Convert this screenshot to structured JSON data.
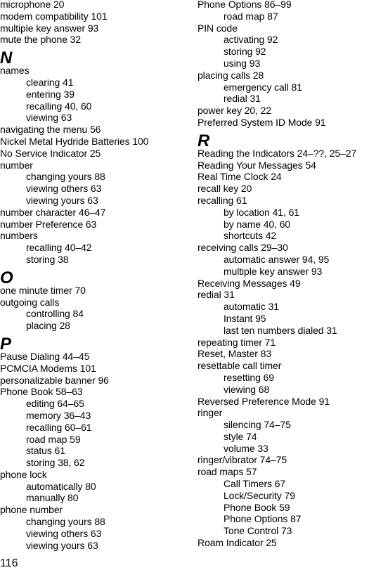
{
  "page_number": "116",
  "left_column": [
    {
      "type": "entry",
      "text": "microphone 20"
    },
    {
      "type": "entry",
      "text": "modem compatibility 101"
    },
    {
      "type": "entry",
      "text": "multiple key answer 93"
    },
    {
      "type": "entry",
      "text": "mute the phone 32"
    },
    {
      "type": "letter",
      "text": "N"
    },
    {
      "type": "entry",
      "text": "names"
    },
    {
      "type": "sub",
      "text": "clearing 41"
    },
    {
      "type": "sub",
      "text": "entering 39"
    },
    {
      "type": "sub",
      "text": "recalling 40, 60"
    },
    {
      "type": "sub",
      "text": "viewing 63"
    },
    {
      "type": "entry",
      "text": "navigating the menu 56"
    },
    {
      "type": "entry",
      "text": "Nickel Metal Hydride Batteries 100"
    },
    {
      "type": "entry",
      "text": "No Service Indicator 25"
    },
    {
      "type": "entry",
      "text": "number"
    },
    {
      "type": "sub",
      "text": "changing yours 88"
    },
    {
      "type": "sub",
      "text": "viewing others 63"
    },
    {
      "type": "sub",
      "text": "viewing yours 63"
    },
    {
      "type": "entry",
      "text": "number character 46–47"
    },
    {
      "type": "entry",
      "text": "number Preference 63"
    },
    {
      "type": "entry",
      "text": "numbers"
    },
    {
      "type": "sub",
      "text": "recalling 40–42"
    },
    {
      "type": "sub",
      "text": "storing 38"
    },
    {
      "type": "letter",
      "text": "O"
    },
    {
      "type": "entry",
      "text": "one minute timer 70"
    },
    {
      "type": "entry",
      "text": "outgoing calls"
    },
    {
      "type": "sub",
      "text": "controlling 84"
    },
    {
      "type": "sub",
      "text": "placing 28"
    },
    {
      "type": "letter",
      "text": "P"
    },
    {
      "type": "entry",
      "text": "Pause Dialing 44–45"
    },
    {
      "type": "entry",
      "text": "PCMCIA Modems 101"
    },
    {
      "type": "entry",
      "text": "personalizable banner 96"
    },
    {
      "type": "entry",
      "text": "Phone Book 58–63"
    },
    {
      "type": "sub",
      "text": "editing 64–65"
    },
    {
      "type": "sub",
      "text": "memory 36–43"
    },
    {
      "type": "sub",
      "text": "recalling 60–61"
    },
    {
      "type": "sub",
      "text": "road map 59"
    },
    {
      "type": "sub",
      "text": "status 61"
    },
    {
      "type": "sub",
      "text": "storing 38, 62"
    },
    {
      "type": "entry",
      "text": "phone lock"
    },
    {
      "type": "sub",
      "text": "automatically 80"
    },
    {
      "type": "sub",
      "text": "manually 80"
    },
    {
      "type": "entry",
      "text": "phone number"
    },
    {
      "type": "sub",
      "text": "changing yours 88"
    },
    {
      "type": "sub",
      "text": "viewing others 63"
    },
    {
      "type": "sub",
      "text": "viewing yours 63"
    }
  ],
  "right_column": [
    {
      "type": "entry",
      "text": "Phone Options 86–99"
    },
    {
      "type": "sub",
      "text": "road map 87"
    },
    {
      "type": "entry",
      "text": "PIN code"
    },
    {
      "type": "sub",
      "text": "activating 92"
    },
    {
      "type": "sub",
      "text": "storing 92"
    },
    {
      "type": "sub",
      "text": "using 93"
    },
    {
      "type": "entry",
      "text": "placing calls 28"
    },
    {
      "type": "sub",
      "text": "emergency call 81"
    },
    {
      "type": "sub",
      "text": "redial 31"
    },
    {
      "type": "entry",
      "text": "power key 20, 22"
    },
    {
      "type": "entry",
      "text": "Preferred System ID Mode 91"
    },
    {
      "type": "letter",
      "text": "R"
    },
    {
      "type": "entry",
      "text": "Reading the Indicators 24–??, 25–27"
    },
    {
      "type": "entry",
      "text": "Reading Your Messages 54"
    },
    {
      "type": "entry",
      "text": "Real Time Clock 24"
    },
    {
      "type": "entry",
      "text": "recall key 20"
    },
    {
      "type": "entry",
      "text": "recalling 61"
    },
    {
      "type": "sub",
      "text": "by location 41, 61"
    },
    {
      "type": "sub",
      "text": "by name 40, 60"
    },
    {
      "type": "sub",
      "text": "shortcuts 42"
    },
    {
      "type": "entry",
      "text": "receiving calls 29–30"
    },
    {
      "type": "sub",
      "text": "automatic answer 94, 95"
    },
    {
      "type": "sub",
      "text": "multiple key answer 93"
    },
    {
      "type": "entry",
      "text": "Receiving Messages 49"
    },
    {
      "type": "entry",
      "text": "redial 31"
    },
    {
      "type": "sub",
      "text": "automatic 31"
    },
    {
      "type": "sub",
      "text": "Instant 95"
    },
    {
      "type": "sub",
      "text": "last ten numbers dialed 31"
    },
    {
      "type": "entry",
      "text": "repeating timer 71"
    },
    {
      "type": "entry",
      "text": "Reset, Master 83"
    },
    {
      "type": "entry",
      "text": "resettable call timer"
    },
    {
      "type": "sub",
      "text": "resetting 69"
    },
    {
      "type": "sub",
      "text": "viewing 68"
    },
    {
      "type": "entry",
      "text": "Reversed Preference Mode 91"
    },
    {
      "type": "entry",
      "text": "ringer"
    },
    {
      "type": "sub",
      "text": "silencing 74–75"
    },
    {
      "type": "sub",
      "text": "style 74"
    },
    {
      "type": "sub",
      "text": "volume 33"
    },
    {
      "type": "entry",
      "text": "ringer/vibrator 74–75"
    },
    {
      "type": "entry",
      "text": "road maps 57"
    },
    {
      "type": "sub",
      "text": "Call Timers 67"
    },
    {
      "type": "sub",
      "text": "Lock/Security 79"
    },
    {
      "type": "sub",
      "text": "Phone Book 59"
    },
    {
      "type": "sub",
      "text": "Phone Options 87"
    },
    {
      "type": "sub",
      "text": "Tone Control 73"
    },
    {
      "type": "entry",
      "text": "Roam Indicator 25"
    }
  ]
}
